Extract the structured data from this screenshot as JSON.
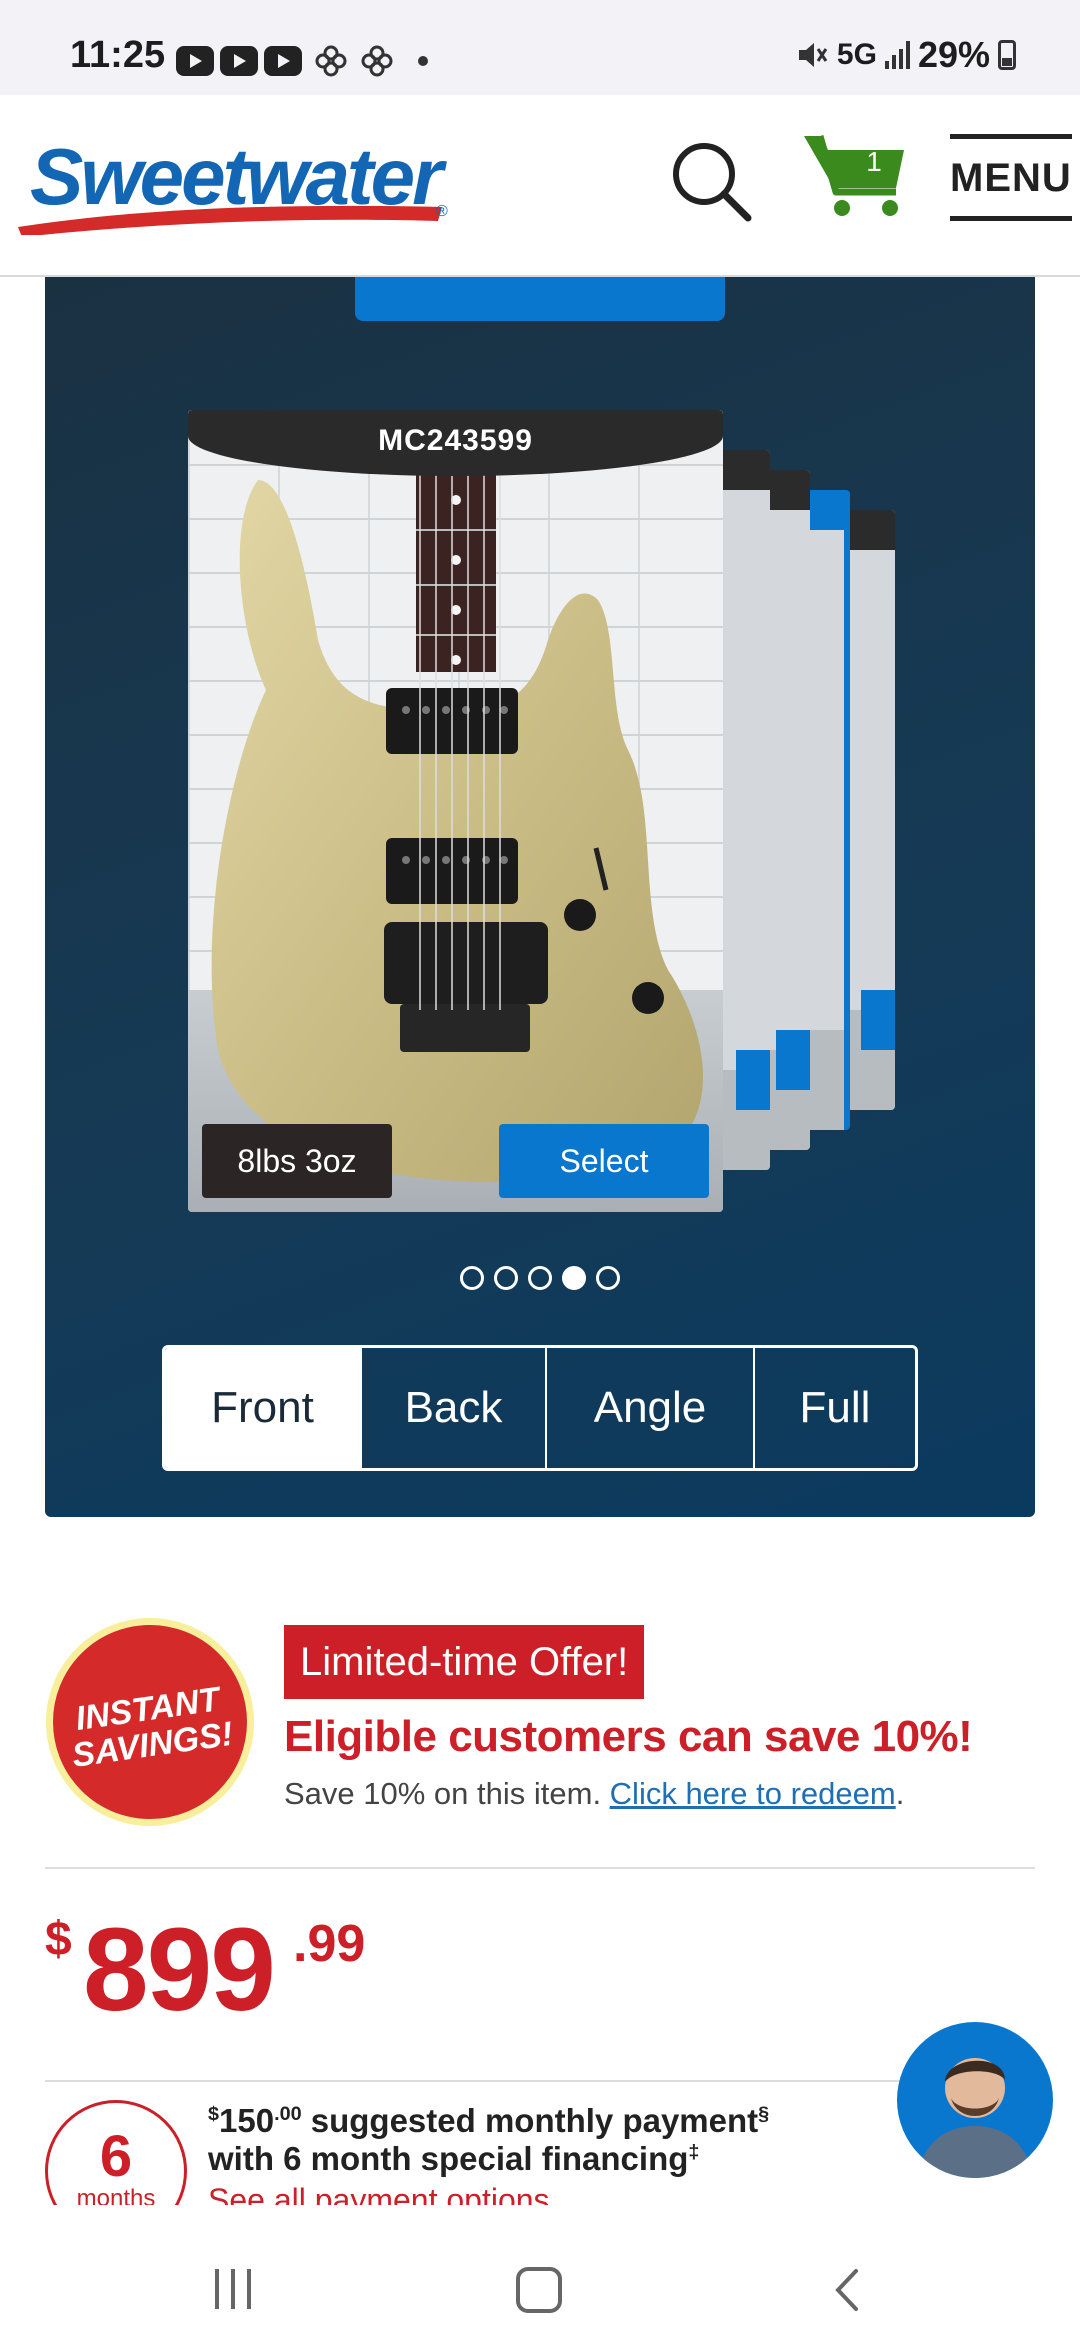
{
  "status_bar": {
    "time": "11:25",
    "network": "5G",
    "battery": "29%"
  },
  "header": {
    "logo_text": "Sweetwater",
    "logo_mark": "®",
    "cart_count": "1",
    "menu_label": "MENU",
    "colors": {
      "brand_blue": "#1266b4",
      "cart_green": "#3a8a1e"
    }
  },
  "gallery": {
    "serial": "MC243599",
    "weight": "8lbs 3oz",
    "select_label": "Select",
    "pager": {
      "count": 5,
      "active_index": 3
    },
    "views": [
      "Front",
      "Back",
      "Angle",
      "Full"
    ],
    "selected_view": "Front"
  },
  "savings": {
    "badge_line1": "INSTANT",
    "badge_line2": "SAVINGS!",
    "pill": "Limited-time Offer!",
    "headline": "Eligible customers can save 10%!",
    "sub_text": "Save 10% on this item. ",
    "sub_link": "Click here to redeem",
    "sub_end": "."
  },
  "price": {
    "currency": "$",
    "dollars": "899",
    "cents": ".99"
  },
  "financing": {
    "months_number": "6",
    "months_label": "months",
    "payment_currency": "$",
    "payment_dollars": "150",
    "payment_cents": ".00",
    "line1_rest": " suggested monthly payment",
    "line1_mark": "§",
    "line2": "with 6 month special financing",
    "line2_mark": "‡",
    "link": "See all payment options"
  }
}
